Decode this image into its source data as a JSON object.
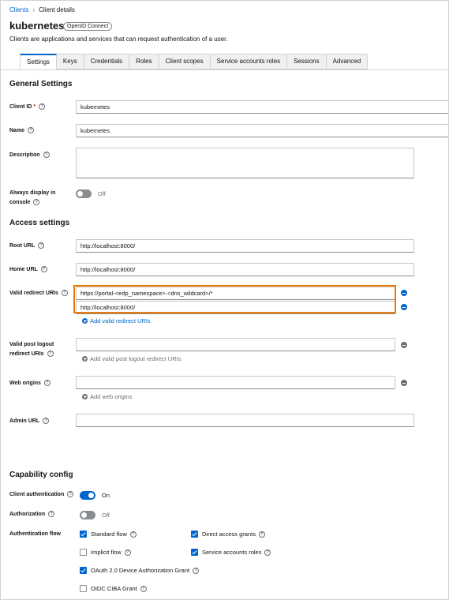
{
  "breadcrumb": {
    "parent": "Clients",
    "separator": "›",
    "current": "Client details"
  },
  "page": {
    "title": "kubernetes",
    "badge": "OpenID Connect",
    "subtitle": "Clients are applications and services that can request authentication of a user."
  },
  "tabs": [
    "Settings",
    "Keys",
    "Credentials",
    "Roles",
    "Client scopes",
    "Service accounts roles",
    "Sessions",
    "Advanced"
  ],
  "general": {
    "heading": "General Settings",
    "client_id": {
      "label": "Client ID",
      "required": "*",
      "value": "kubernetes"
    },
    "name": {
      "label": "Name",
      "value": "kubernetes"
    },
    "description": {
      "label": "Description",
      "value": ""
    },
    "always_display": {
      "label_line1": "Always display in",
      "label_line2": "console",
      "state": "Off"
    }
  },
  "access": {
    "heading": "Access settings",
    "root_url": {
      "label": "Root URL",
      "value": "http://localhost:8000/"
    },
    "home_url": {
      "label": "Home URL",
      "value": "http://localhost:8000/"
    },
    "valid_redirect": {
      "label": "Valid redirect URIs",
      "values": [
        "https://portal-<edp_namespace>.<dns_wildcard>/*",
        "http://localhost:8000/"
      ],
      "add_label": "Add valid redirect URIs"
    },
    "post_logout": {
      "label_line1": "Valid post logout",
      "label_line2": "redirect URIs",
      "value": "",
      "add_label": "Add valid post logout redirect URIs"
    },
    "web_origins": {
      "label": "Web origins",
      "value": "",
      "add_label": "Add web origins"
    },
    "admin_url": {
      "label": "Admin URL",
      "value": ""
    }
  },
  "capability": {
    "heading": "Capability config",
    "client_auth": {
      "label": "Client authentication",
      "state": "On"
    },
    "authorization": {
      "label": "Authorization",
      "state": "Off"
    },
    "auth_flow": {
      "label": "Authentication flow",
      "standard": {
        "label": "Standard flow",
        "checked": true
      },
      "direct": {
        "label": "Direct access grants",
        "checked": true
      },
      "implicit": {
        "label": "Implicit flow",
        "checked": false
      },
      "service_accounts": {
        "label": "Service accounts roles",
        "checked": true
      },
      "device": {
        "label": "OAuth 2.0 Device Authorization Grant",
        "checked": true
      },
      "ciba": {
        "label": "OIDC CIBA Grant",
        "checked": false
      }
    }
  },
  "help_glyph": "?",
  "colors": {
    "primary": "#0066cc",
    "highlight": "#ec7a08",
    "required": "#c9190b"
  }
}
